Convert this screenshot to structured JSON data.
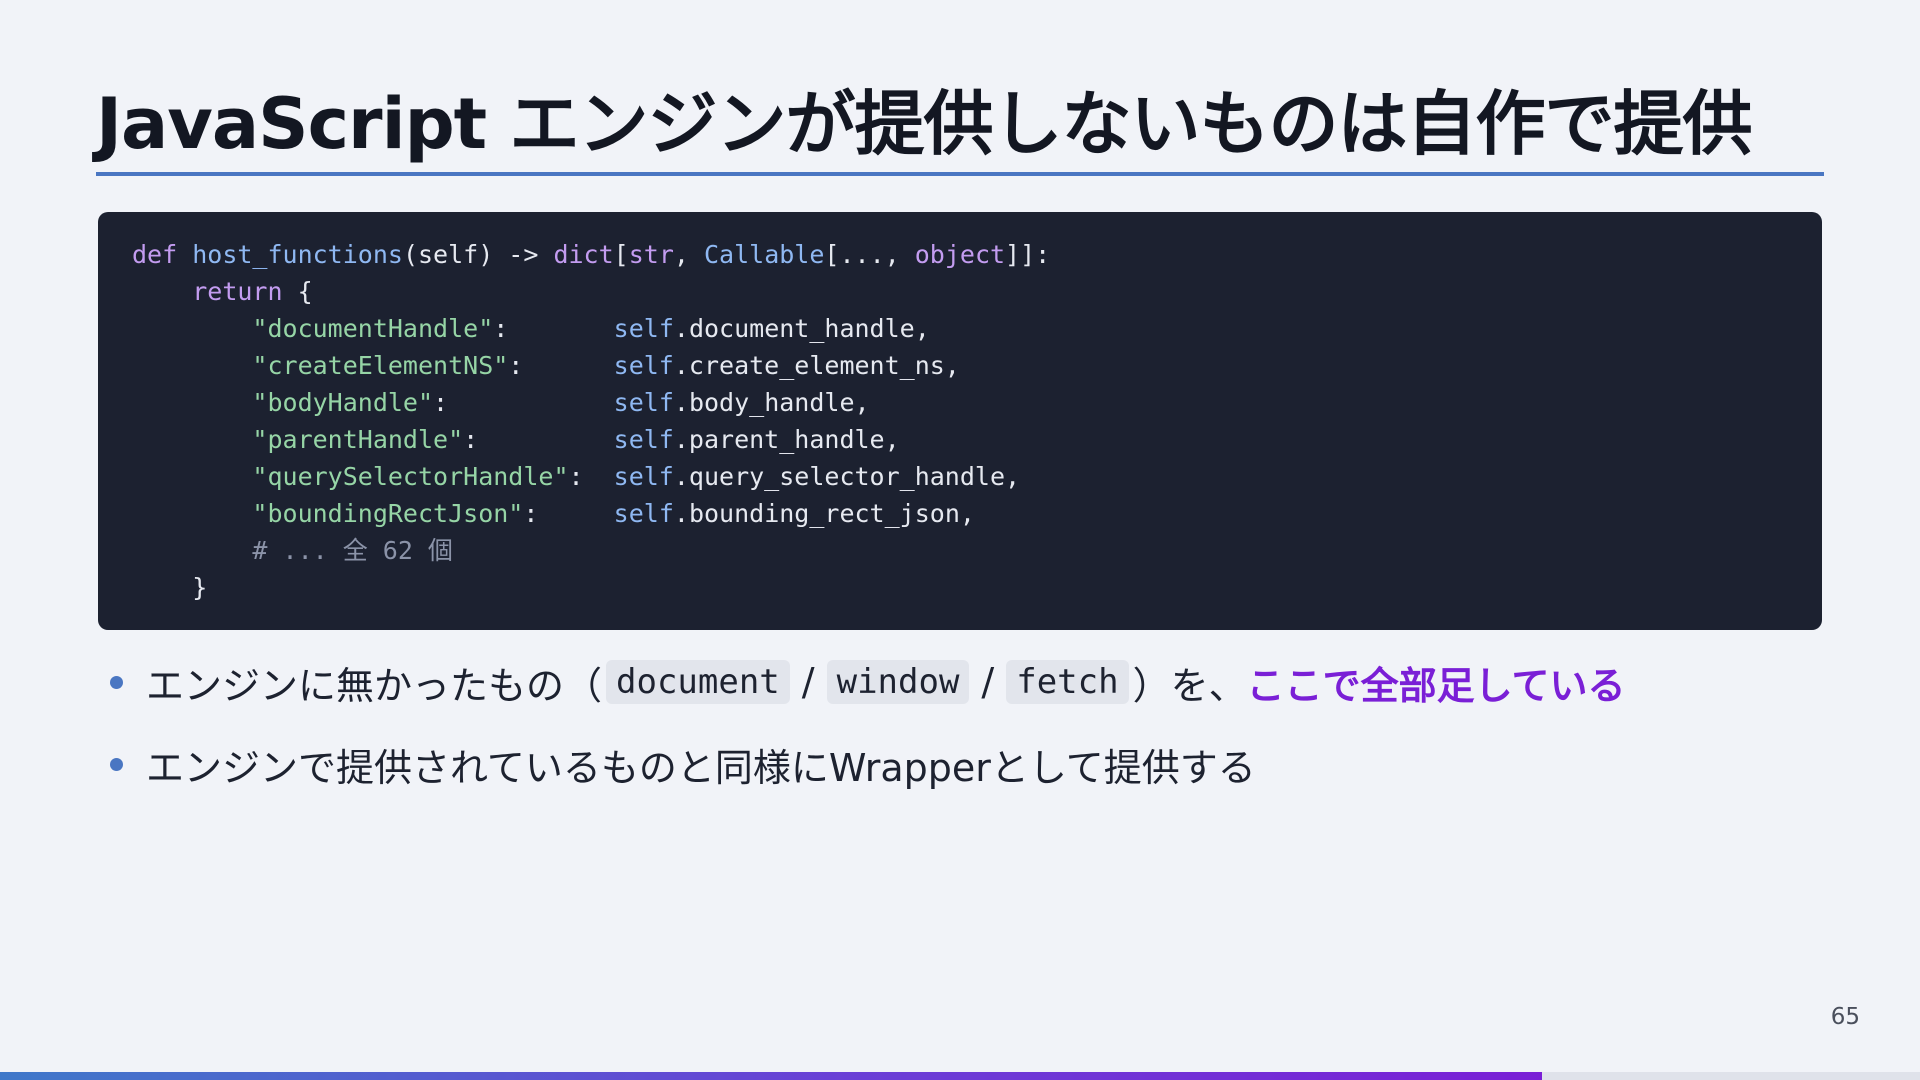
{
  "slide": {
    "title": "JavaScript エンジンが提供しないものは自作で提供",
    "page_number": "65",
    "progress": 0.803
  },
  "code": {
    "language": "python",
    "lines": [
      [
        {
          "t": "def",
          "c": "kw"
        },
        {
          "t": " ",
          "c": "plain"
        },
        {
          "t": "host_functions",
          "c": "fn"
        },
        {
          "t": "(self) -> ",
          "c": "plain"
        },
        {
          "t": "dict",
          "c": "type"
        },
        {
          "t": "[",
          "c": "plain"
        },
        {
          "t": "str",
          "c": "type"
        },
        {
          "t": ", ",
          "c": "plain"
        },
        {
          "t": "Callable",
          "c": "builtin"
        },
        {
          "t": "[..., ",
          "c": "plain"
        },
        {
          "t": "object",
          "c": "type"
        },
        {
          "t": "]]:",
          "c": "plain"
        }
      ],
      [
        {
          "t": "    ",
          "c": "plain"
        },
        {
          "t": "return",
          "c": "kw"
        },
        {
          "t": " {",
          "c": "plain"
        }
      ],
      [
        {
          "t": "        ",
          "c": "plain"
        },
        {
          "t": "\"documentHandle\"",
          "c": "str"
        },
        {
          "t": ":       ",
          "c": "plain"
        },
        {
          "t": "self",
          "c": "self"
        },
        {
          "t": ".document_handle,",
          "c": "plain"
        }
      ],
      [
        {
          "t": "        ",
          "c": "plain"
        },
        {
          "t": "\"createElementNS\"",
          "c": "str"
        },
        {
          "t": ":      ",
          "c": "plain"
        },
        {
          "t": "self",
          "c": "self"
        },
        {
          "t": ".create_element_ns,",
          "c": "plain"
        }
      ],
      [
        {
          "t": "        ",
          "c": "plain"
        },
        {
          "t": "\"bodyHandle\"",
          "c": "str"
        },
        {
          "t": ":           ",
          "c": "plain"
        },
        {
          "t": "self",
          "c": "self"
        },
        {
          "t": ".body_handle,",
          "c": "plain"
        }
      ],
      [
        {
          "t": "        ",
          "c": "plain"
        },
        {
          "t": "\"parentHandle\"",
          "c": "str"
        },
        {
          "t": ":         ",
          "c": "plain"
        },
        {
          "t": "self",
          "c": "self"
        },
        {
          "t": ".parent_handle,",
          "c": "plain"
        }
      ],
      [
        {
          "t": "        ",
          "c": "plain"
        },
        {
          "t": "\"querySelectorHandle\"",
          "c": "str"
        },
        {
          "t": ":  ",
          "c": "plain"
        },
        {
          "t": "self",
          "c": "self"
        },
        {
          "t": ".query_selector_handle,",
          "c": "plain"
        }
      ],
      [
        {
          "t": "        ",
          "c": "plain"
        },
        {
          "t": "\"boundingRectJson\"",
          "c": "str"
        },
        {
          "t": ":     ",
          "c": "plain"
        },
        {
          "t": "self",
          "c": "self"
        },
        {
          "t": ".bounding_rect_json,",
          "c": "plain"
        }
      ],
      [
        {
          "t": "        ",
          "c": "plain"
        },
        {
          "t": "# ... 全 62 個",
          "c": "comment"
        }
      ],
      [
        {
          "t": "    }",
          "c": "plain"
        }
      ]
    ]
  },
  "bullets": [
    {
      "before": "エンジンに無かったもの（",
      "codes": [
        "document",
        "window",
        "fetch"
      ],
      "separator": "/",
      "after": "）を、",
      "emphasis": "ここで全部足している"
    },
    {
      "text": "エンジンで提供されているものと同様にWrapperとして提供する"
    }
  ],
  "colors": {
    "accent": "#4a76c2",
    "emphasis": "#7a1fd6",
    "code_background": "#1c2130"
  }
}
